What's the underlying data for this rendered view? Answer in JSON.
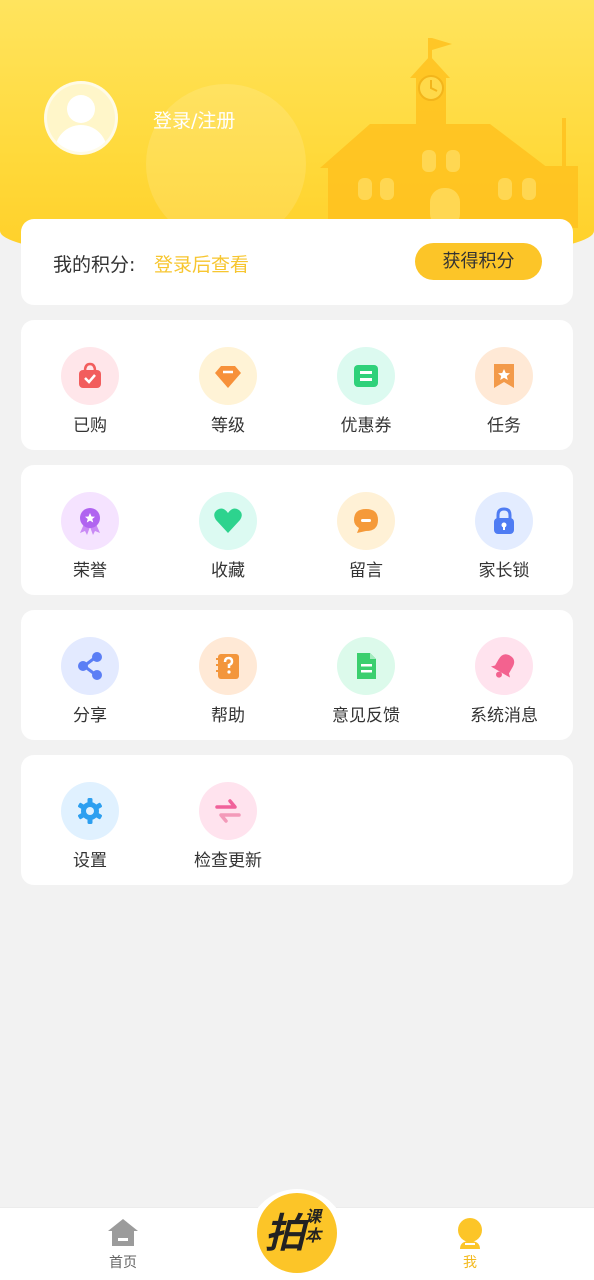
{
  "header": {
    "login_text": "登录/注册"
  },
  "points": {
    "label": "我的积分:",
    "value": "登录后查看",
    "button": "获得积分"
  },
  "menu_groups": [
    [
      {
        "label": "已购",
        "icon": "shopping-bag-icon",
        "color": "#f25d5d"
      },
      {
        "label": "等级",
        "icon": "diamond-icon",
        "color": "#f7913a"
      },
      {
        "label": "优惠券",
        "icon": "coupon-icon",
        "color": "#2fd17a"
      },
      {
        "label": "任务",
        "icon": "bookmark-star-icon",
        "color": "#f39a4a"
      }
    ],
    [
      {
        "label": "荣誉",
        "icon": "medal-icon",
        "color": "#b064f0"
      },
      {
        "label": "收藏",
        "icon": "heart-icon",
        "color": "#2dd38e"
      },
      {
        "label": "留言",
        "icon": "chat-bubble-icon",
        "color": "#f59a3a"
      },
      {
        "label": "家长锁",
        "icon": "lock-icon",
        "color": "#4f7cf3"
      }
    ],
    [
      {
        "label": "分享",
        "icon": "share-icon",
        "color": "#5b7ef5"
      },
      {
        "label": "帮助",
        "icon": "help-book-icon",
        "color": "#f3963c"
      },
      {
        "label": "意见反馈",
        "icon": "document-icon",
        "color": "#3bcf6e"
      },
      {
        "label": "系统消息",
        "icon": "bell-icon",
        "color": "#f3628f"
      }
    ],
    [
      {
        "label": "设置",
        "icon": "gear-icon",
        "color": "#2d9ff0"
      },
      {
        "label": "检查更新",
        "icon": "update-arrows-icon",
        "color": "#f0619a"
      }
    ]
  ],
  "tabbar": {
    "home": "首页",
    "center_big": "拍",
    "center_small": "课本",
    "me": "我"
  },
  "colors": {
    "accent": "#fcc528",
    "header_bg": "#ffd93a"
  }
}
